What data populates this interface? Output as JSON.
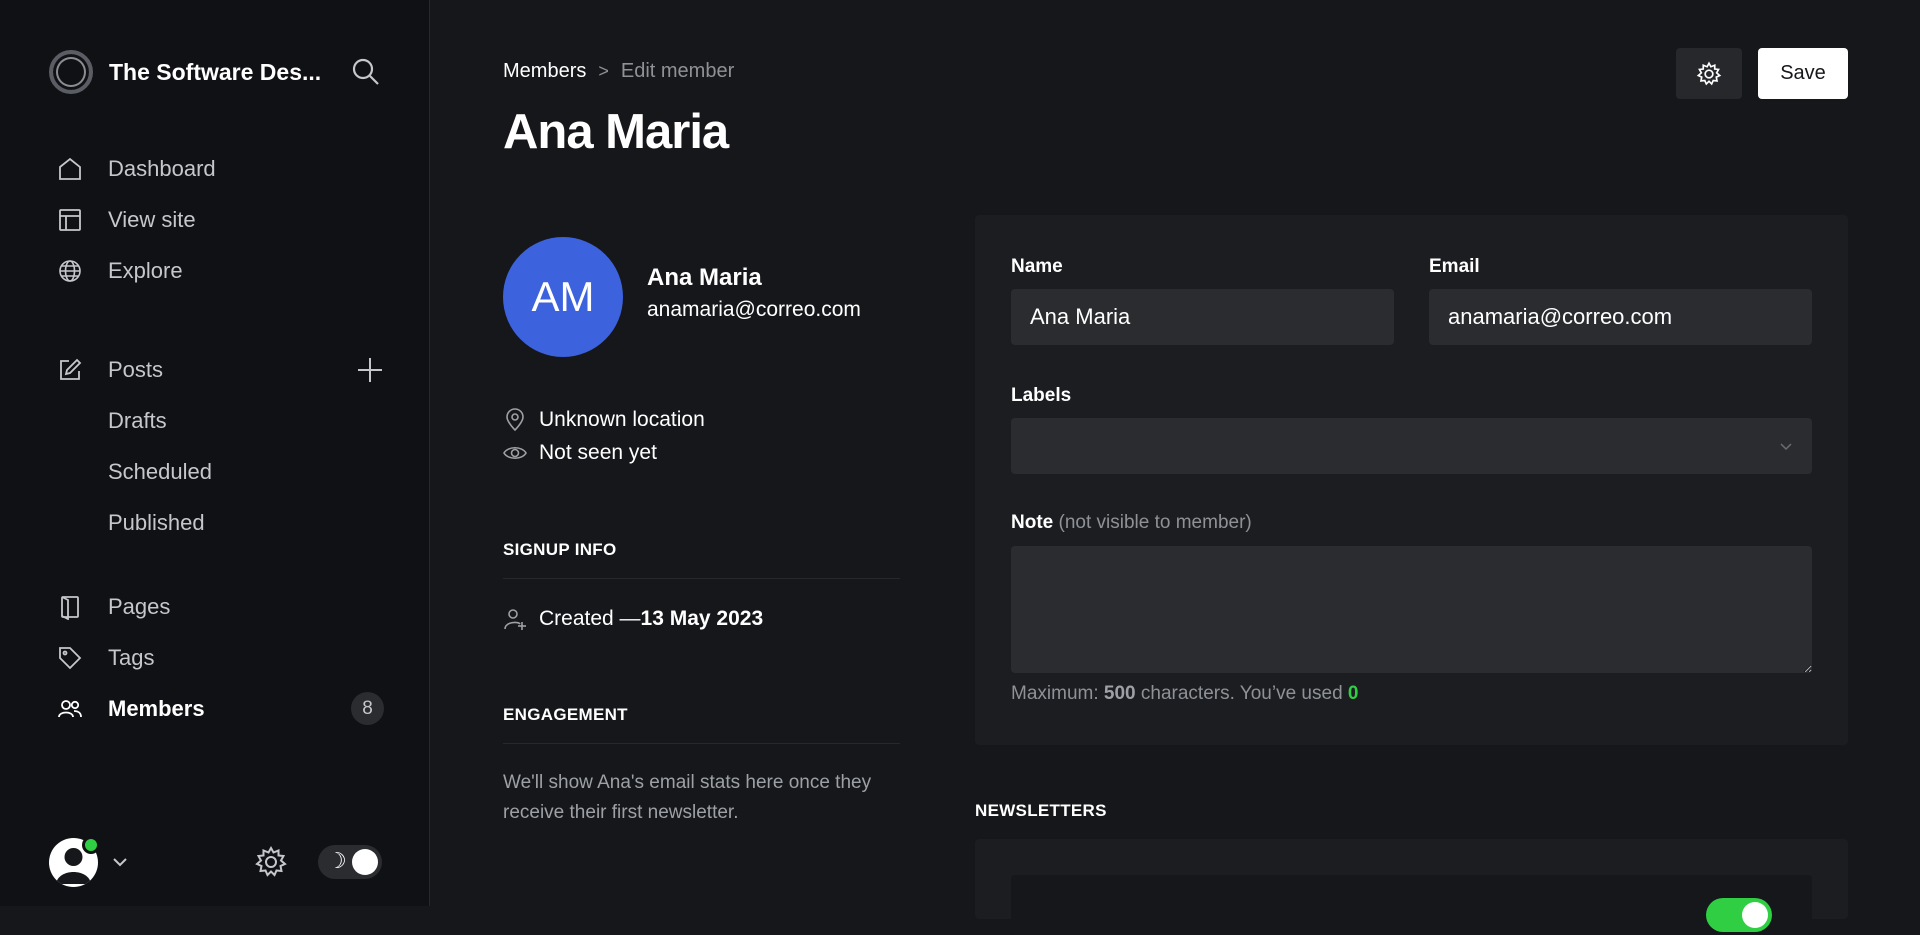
{
  "brand": {
    "title": "The Software Des..."
  },
  "sidebar": {
    "items": [
      {
        "label": "Dashboard",
        "icon": "home-icon"
      },
      {
        "label": "View site",
        "icon": "layout-icon"
      },
      {
        "label": "Explore",
        "icon": "globe-icon"
      },
      {
        "label": "Posts",
        "icon": "pencil-square-icon"
      },
      {
        "label": "Drafts"
      },
      {
        "label": "Scheduled"
      },
      {
        "label": "Published"
      },
      {
        "label": "Pages",
        "icon": "page-icon"
      },
      {
        "label": "Tags",
        "icon": "tag-icon"
      },
      {
        "label": "Members",
        "icon": "users-icon",
        "count": "8",
        "active": true
      }
    ]
  },
  "header": {
    "breadcrumb_parent": "Members",
    "breadcrumb_separator": ">",
    "breadcrumb_current": "Edit member",
    "title": "Ana Maria",
    "save_label": "Save"
  },
  "member": {
    "initials": "AM",
    "name": "Ana Maria",
    "email": "anamaria@correo.com",
    "location": "Unknown location",
    "last_seen": "Not seen yet",
    "avatar_color": "#3c62dd"
  },
  "signup": {
    "heading": "SIGNUP INFO",
    "created_prefix": "Created — ",
    "created_date": "13 May 2023"
  },
  "engagement": {
    "heading": "ENGAGEMENT",
    "text": "We'll show Ana's email stats here once they receive their first newsletter."
  },
  "form": {
    "name_label": "Name",
    "name_value": "Ana Maria",
    "email_label": "Email",
    "email_value": "anamaria@correo.com",
    "labels_label": "Labels",
    "note_label": "Note",
    "note_hint": "(not visible to member)",
    "note_value": "",
    "max_prefix": "Maximum: ",
    "max_chars": "500",
    "used_text": " characters. You’ve used ",
    "used_count": "0"
  },
  "newsletters": {
    "heading": "NEWSLETTERS",
    "enabled": true
  },
  "colors": {
    "accent_green": "#30cf43",
    "background": "#15171a",
    "sidebar": "#101114"
  }
}
